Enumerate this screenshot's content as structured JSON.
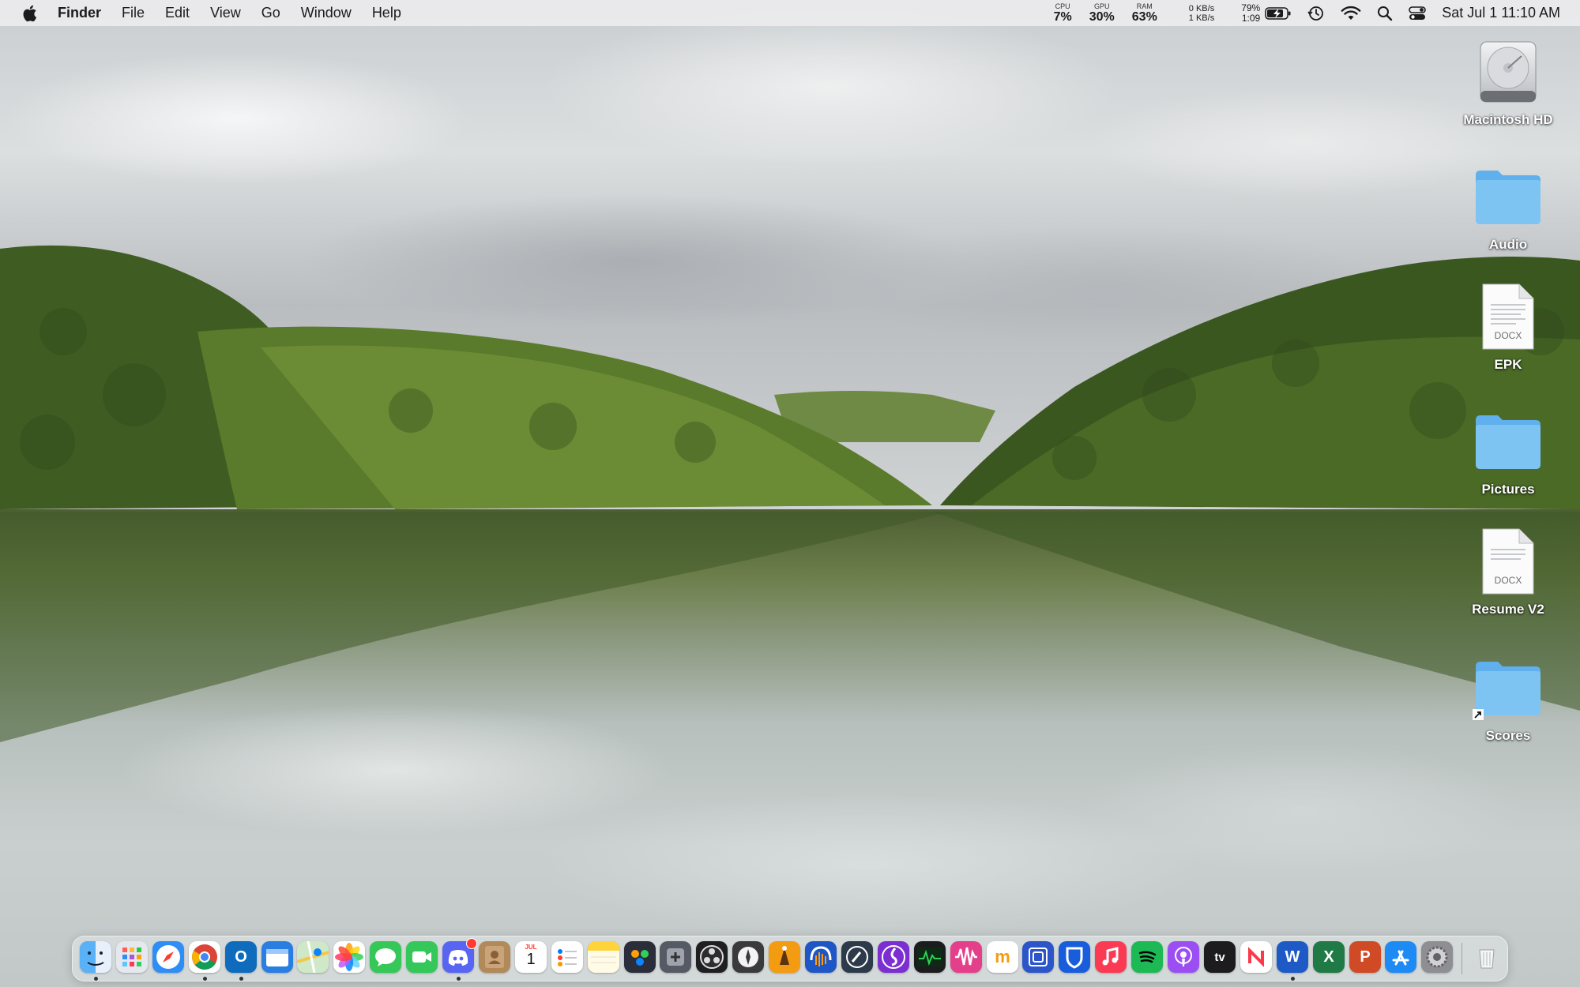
{
  "menubar": {
    "app_name": "Finder",
    "menus": [
      "File",
      "Edit",
      "View",
      "Go",
      "Window",
      "Help"
    ],
    "stats": {
      "cpu": {
        "label": "CPU",
        "value": "7%"
      },
      "gpu": {
        "label": "GPU",
        "value": "30%"
      },
      "ram": {
        "label": "RAM",
        "value": "63%"
      }
    },
    "network": {
      "down": "0 KB/s",
      "up": "1 KB/s"
    },
    "battery": {
      "percent": "79%",
      "time": "1:09"
    },
    "clock": "Sat Jul 1  11:10 AM"
  },
  "desktop_icons": [
    {
      "label": "Macintosh HD",
      "icon": "hard-drive-icon"
    },
    {
      "label": "Audio",
      "icon": "folder-icon"
    },
    {
      "label": "EPK",
      "icon": "docx-document-icon",
      "badge": "DOCX"
    },
    {
      "label": "Pictures",
      "icon": "folder-icon"
    },
    {
      "label": "Resume V2",
      "icon": "docx-document-icon",
      "badge": "DOCX"
    },
    {
      "label": "Scores",
      "icon": "folder-alias-icon"
    }
  ],
  "dock": {
    "calendar_month": "JUL",
    "calendar_day": "1",
    "tv_label": "tv",
    "items": [
      {
        "name": "finder",
        "color": "#3d8ef0",
        "running": true
      },
      {
        "name": "launchpad",
        "color": "#e6e8ef"
      },
      {
        "name": "safari",
        "color": "#2f8ef5"
      },
      {
        "name": "chrome",
        "color": "#ffffff",
        "running": true
      },
      {
        "name": "outlook",
        "color": "#0f6cbd",
        "running": true
      },
      {
        "name": "files",
        "color": "#2a7de1"
      },
      {
        "name": "maps",
        "color": "#6cc86a"
      },
      {
        "name": "photos",
        "color": "#ffffff"
      },
      {
        "name": "messages",
        "color": "#36c759"
      },
      {
        "name": "facetime",
        "color": "#34c759"
      },
      {
        "name": "discord",
        "color": "#5865f2",
        "running": true,
        "badge": true
      },
      {
        "name": "contacts",
        "color": "#b28a5a"
      },
      {
        "name": "calendar",
        "color": "#ffffff"
      },
      {
        "name": "reminders",
        "color": "#ffffff"
      },
      {
        "name": "notes",
        "color": "#ffd43b"
      },
      {
        "name": "davinci-resolve",
        "color": "#2b2e3a"
      },
      {
        "name": "compressor",
        "color": "#555a64"
      },
      {
        "name": "obs",
        "color": "#1f1f22"
      },
      {
        "name": "motion",
        "color": "#3a3a3c"
      },
      {
        "name": "garageband",
        "color": "#f39c12"
      },
      {
        "name": "audacity",
        "color": "#1e56c5"
      },
      {
        "name": "logic",
        "color": "#2d3a4a"
      },
      {
        "name": "musescore",
        "color": "#7b2fd0"
      },
      {
        "name": "activity-monitor",
        "color": "#1c1c1e"
      },
      {
        "name": "soundwave",
        "color": "#e43f8b"
      },
      {
        "name": "memo",
        "color": "#ffffff"
      },
      {
        "name": "vpn",
        "color": "#2b55c9"
      },
      {
        "name": "bitwarden",
        "color": "#175ddc"
      },
      {
        "name": "music",
        "color": "#fb3b54"
      },
      {
        "name": "spotify",
        "color": "#1db954"
      },
      {
        "name": "podcasts",
        "color": "#9b4ff2"
      },
      {
        "name": "apple-tv",
        "color": "#1c1c1e"
      },
      {
        "name": "news",
        "color": "#ffffff"
      },
      {
        "name": "word",
        "color": "#1e5ac6",
        "running": true
      },
      {
        "name": "excel",
        "color": "#1f7a45"
      },
      {
        "name": "powerpoint",
        "color": "#d04a26"
      },
      {
        "name": "app-store",
        "color": "#1e8bf5"
      },
      {
        "name": "system-settings",
        "color": "#8e8e93"
      },
      {
        "name": "trash",
        "color": "#e4e7ea"
      }
    ]
  }
}
